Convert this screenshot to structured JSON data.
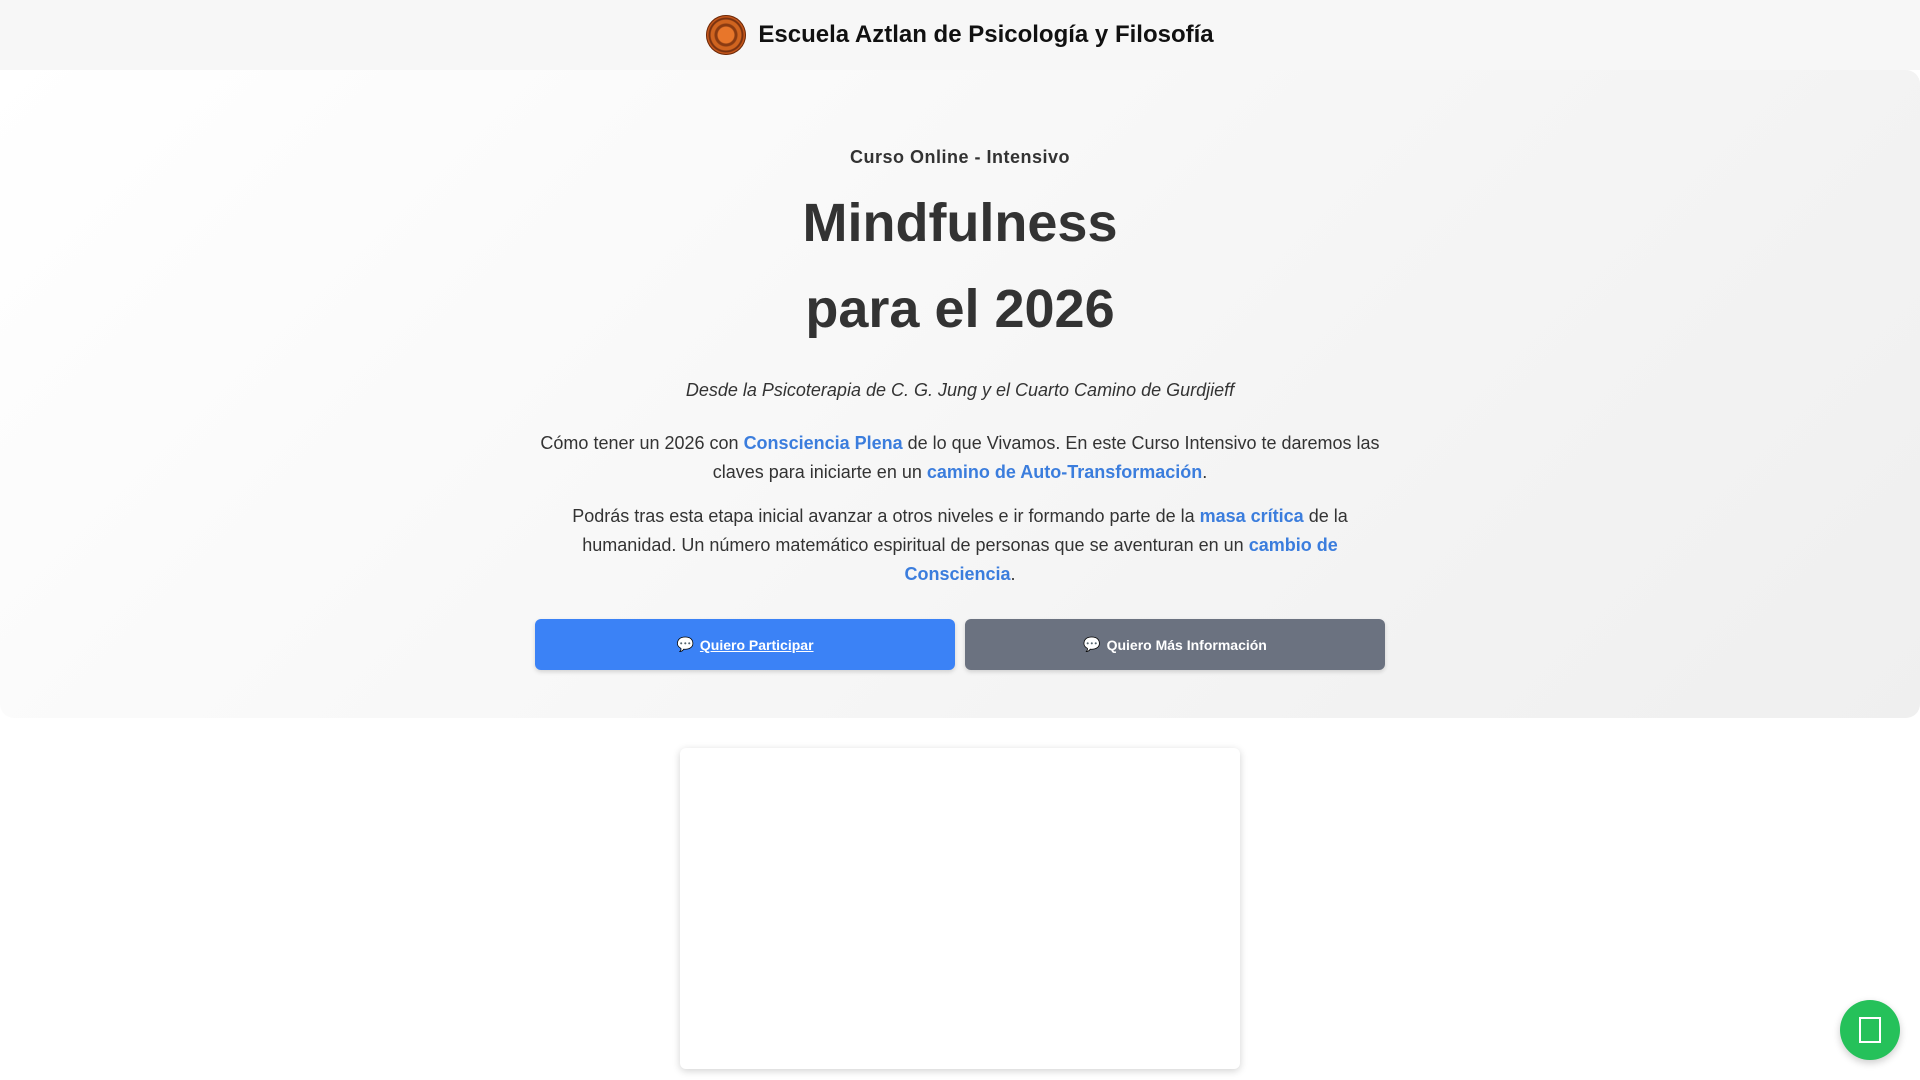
{
  "header": {
    "logo_icon": "aztec-sun-stone-logo",
    "site_title": "Escuela Aztlan de Psicología y Filosofía"
  },
  "hero": {
    "overline": "Curso Online - Intensivo",
    "headline_line1": "Mindfulness",
    "headline_line2": "para el 2026",
    "subtitle": "Desde la Psicoterapia de C. G. Jung y el Cuarto Camino de Gurdjieff",
    "para1": {
      "t1": "Cómo tener un 2026 con ",
      "hl1": "Consciencia Plena",
      "t2": " de lo que Vivamos. En este Curso Intensivo te daremos las claves para iniciarte en un ",
      "hl2": "camino de Auto-Transformación",
      "t3": "."
    },
    "para2": {
      "t1": "Podrás tras esta etapa inicial avanzar a otros niveles e ir formando parte de la ",
      "hl1": "masa crítica",
      "t2": " de la humanidad. Un número matemático espiritual de personas que se aventuran en un ",
      "hl2": "cambio de Consciencia",
      "t3": "."
    },
    "buttons": {
      "participate_label": "Quiero Participar",
      "info_label": "Quiero Más Información",
      "icon_glyph": "💬",
      "primary_color": "#3b82f6",
      "secondary_color": "#6b7280"
    },
    "highlight_color": "#3b7ddd"
  },
  "floating": {
    "whatsapp_icon": "whatsapp-icon",
    "whatsapp_color": "#25c15a"
  }
}
